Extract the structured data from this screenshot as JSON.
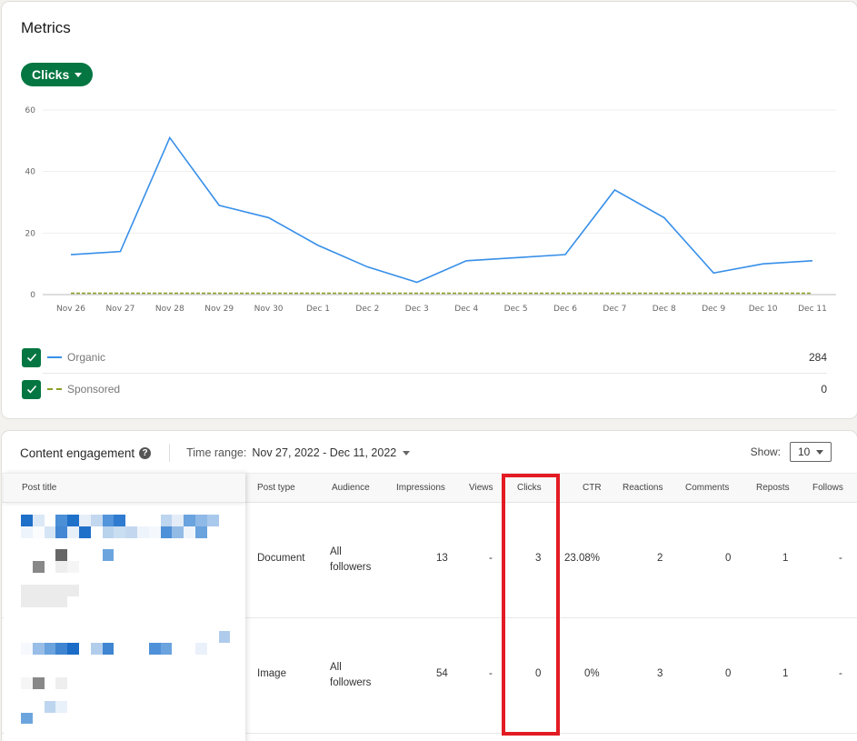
{
  "metrics": {
    "title": "Metrics",
    "metric_selector": "Clicks",
    "legend": [
      {
        "label": "Organic",
        "total": "284",
        "checked": true,
        "color": "#378fe9",
        "style": "solid"
      },
      {
        "label": "Sponsored",
        "total": "0",
        "checked": true,
        "color": "#8a9e25",
        "style": "dashed"
      }
    ]
  },
  "chart_data": {
    "type": "line",
    "title": "",
    "xlabel": "",
    "ylabel": "",
    "ylim": [
      0,
      60
    ],
    "yticks": [
      0,
      20,
      40,
      60
    ],
    "grid": true,
    "categories": [
      "Nov 26",
      "Nov 27",
      "Nov 28",
      "Nov 29",
      "Nov 30",
      "Dec 1",
      "Dec 2",
      "Dec 3",
      "Dec 4",
      "Dec 5",
      "Dec 6",
      "Dec 7",
      "Dec 8",
      "Dec 9",
      "Dec 10",
      "Dec 11"
    ],
    "series": [
      {
        "name": "Organic",
        "color": "#378fe9",
        "values": [
          13,
          14,
          51,
          29,
          25,
          16,
          9,
          4,
          11,
          12,
          13,
          34,
          25,
          7,
          10,
          11
        ]
      },
      {
        "name": "Sponsored",
        "color": "#8a9e25",
        "values": [
          0,
          0,
          0,
          0,
          0,
          0,
          0,
          0,
          0,
          0,
          0,
          0,
          0,
          0,
          0,
          0
        ]
      }
    ]
  },
  "engagement": {
    "title": "Content engagement",
    "help_icon": "?",
    "time_range_label": "Time range:",
    "time_range_value": "Nov 27, 2022 - Dec 11, 2022",
    "show_label": "Show:",
    "show_value": "10",
    "columns": [
      "Post title",
      "Post type",
      "Audience",
      "Impressions",
      "Views",
      "Clicks",
      "CTR",
      "Reactions",
      "Comments",
      "Reposts",
      "Follows"
    ],
    "rows": [
      {
        "post_type": "Document",
        "audience": "All followers",
        "impressions": "13",
        "views": "-",
        "clicks": "3",
        "ctr": "23.08%",
        "reactions": "2",
        "comments": "0",
        "reposts": "1",
        "follows": "-"
      },
      {
        "post_type": "Image",
        "audience": "All followers",
        "impressions": "54",
        "views": "-",
        "clicks": "0",
        "ctr": "0%",
        "reactions": "3",
        "comments": "0",
        "reposts": "1",
        "follows": "-"
      }
    ],
    "highlighted_column": "Clicks",
    "highlight_color": "#e31b23"
  }
}
